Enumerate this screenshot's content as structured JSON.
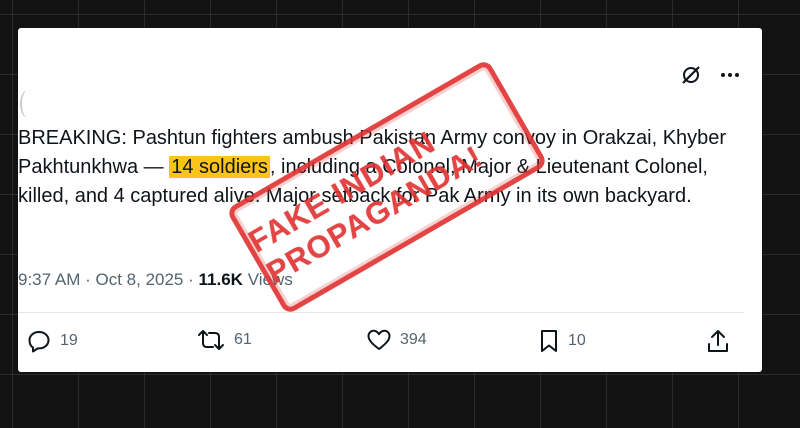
{
  "tweet": {
    "text_part1": "BREAKING: Pashtun fighters ambush Pakistan Army convoy in Orakzai, Khyber Pakhtunkhwa — ",
    "highlight": "14 soldiers",
    "text_part2": ", including a Colonel, Major & Lieutenant Colonel, killed, and 4 captured alive. Major setback for Pak Army in its own backyard.",
    "time": "9:37 AM",
    "date": "Oct 8, 2025",
    "views_count": "11.6K",
    "views_label": "Views"
  },
  "stamp": {
    "text": "FAKE INDIAN PROPAGANDA!"
  },
  "actions": {
    "replies": "19",
    "reposts": "61",
    "likes": "394",
    "bookmarks": "10"
  },
  "icons": {
    "top": [
      "grok-icon",
      "more-icon"
    ],
    "bar": [
      "reply-icon",
      "repost-icon",
      "like-icon",
      "bookmark-icon",
      "share-icon"
    ]
  },
  "colors": {
    "stamp": "#e03131",
    "highlight": "#fcc419",
    "text": "#0f1419",
    "muted": "#536471"
  }
}
